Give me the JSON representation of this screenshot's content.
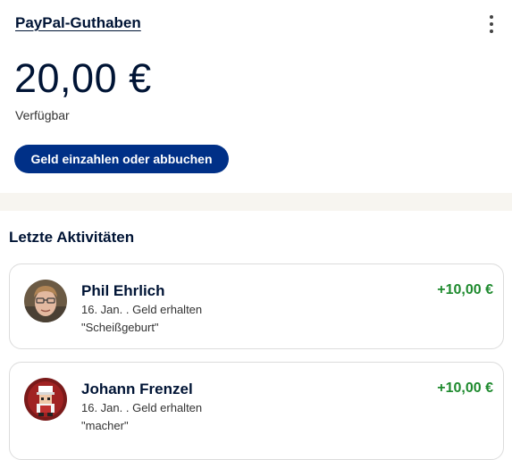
{
  "balance": {
    "title": "PayPal-Guthaben",
    "amount": "20,00 €",
    "available_label": "Verfügbar",
    "action_label": "Geld einzahlen oder abbuchen",
    "menu_icon": "kebab-vertical-icon"
  },
  "activity": {
    "heading": "Letzte Aktivitäten",
    "items": [
      {
        "name": "Phil Ehrlich",
        "meta": "16. Jan. . Geld erhalten",
        "note": "\"Scheißgeburt\"",
        "amount": "+10,00 €"
      },
      {
        "name": "Johann Frenzel",
        "meta": "16. Jan. . Geld erhalten",
        "note": "\"macher\"",
        "amount": "+10,00 €"
      }
    ]
  },
  "colors": {
    "primary": "#003087",
    "text": "#001435",
    "positive": "#1e8a2e",
    "separator": "#f7f5f0"
  }
}
